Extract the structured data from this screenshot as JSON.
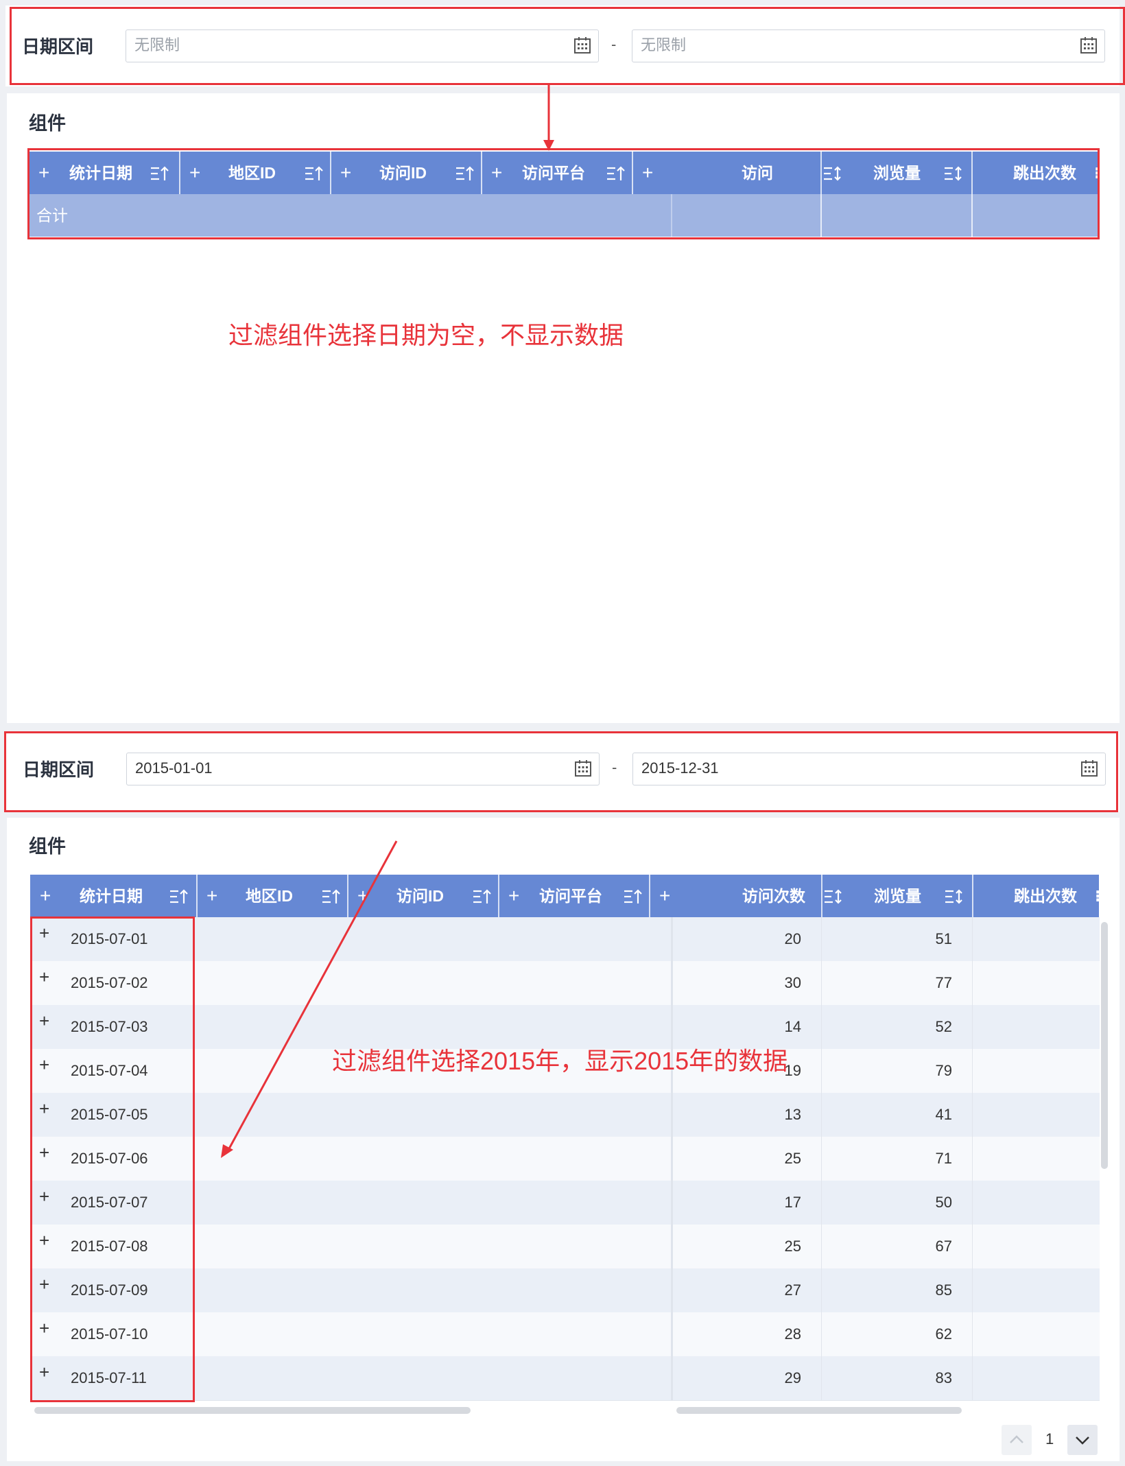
{
  "filter_top": {
    "label": "日期区间",
    "start_placeholder": "无限制",
    "end_placeholder": "无限制",
    "separator": "-"
  },
  "filter_bottom": {
    "label": "日期区间",
    "start_value": "2015-01-01",
    "end_value": "2015-12-31",
    "separator": "-"
  },
  "component_title": "组件",
  "columns": [
    "统计日期",
    "地区ID",
    "访问ID",
    "访问平台",
    "访问次数",
    "浏览量",
    "跳出次数"
  ],
  "summary_label": "合计",
  "annotation_top": "过滤组件选择日期为空，不显示数据",
  "annotation_bottom": "过滤组件选择2015年，显示2015年的数据",
  "rows": [
    {
      "date": "2015-07-01",
      "visits": "20",
      "views": "51"
    },
    {
      "date": "2015-07-02",
      "visits": "30",
      "views": "77"
    },
    {
      "date": "2015-07-03",
      "visits": "14",
      "views": "52"
    },
    {
      "date": "2015-07-04",
      "visits": "19",
      "views": "79"
    },
    {
      "date": "2015-07-05",
      "visits": "13",
      "views": "41"
    },
    {
      "date": "2015-07-06",
      "visits": "25",
      "views": "71"
    },
    {
      "date": "2015-07-07",
      "visits": "17",
      "views": "50"
    },
    {
      "date": "2015-07-08",
      "visits": "25",
      "views": "67"
    },
    {
      "date": "2015-07-09",
      "visits": "27",
      "views": "85"
    },
    {
      "date": "2015-07-10",
      "visits": "28",
      "views": "62"
    },
    {
      "date": "2015-07-11",
      "visits": "29",
      "views": "83"
    }
  ],
  "pagination": {
    "page": "1"
  },
  "colors": {
    "header": "#6688d4",
    "summary": "#9fb4e2",
    "annotation": "#e8333a"
  },
  "icons": [
    "calendar-icon",
    "sort-asc-icon",
    "sort-icon",
    "expand-plus-icon",
    "chevron-up-icon",
    "chevron-down-icon"
  ]
}
